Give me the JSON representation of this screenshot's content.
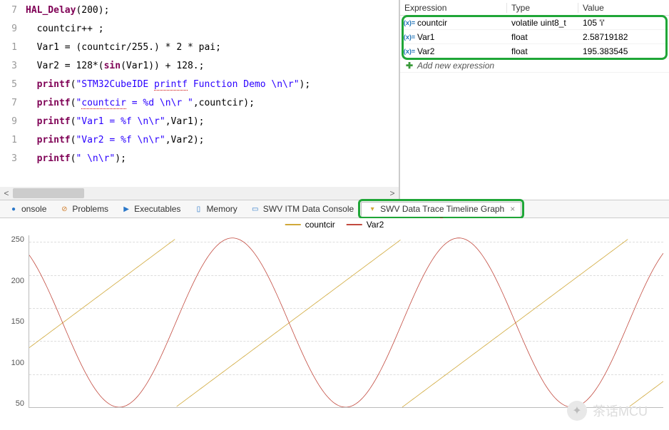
{
  "code": {
    "lines": [
      {
        "n": 7,
        "html": "<span class='kw'>HAL_Delay</span>(200);"
      },
      {
        "n": 9,
        "html": "  countcir++ ;"
      },
      {
        "n": 1,
        "html": "  Var1 = (countcir/255.) * 2 * pai;"
      },
      {
        "n": 3,
        "html": "  Var2 = 128*(<span class='kw'>sin</span>(Var1)) + 128.;"
      },
      {
        "n": 5,
        "html": "  <span class='kw'>printf</span>(<span class='str'>&quot;STM32CubeIDE <span class='squig'>printf</span> Function Demo \\n\\r&quot;</span>);"
      },
      {
        "n": 7,
        "html": "  <span class='kw'>printf</span>(<span class='str'>&quot;<span class='squig'>countcir</span> = %d \\n\\r &quot;</span>,countcir);"
      },
      {
        "n": 9,
        "html": "  <span class='kw'>printf</span>(<span class='str'>&quot;Var1 = %f \\n\\r&quot;</span>,Var1);"
      },
      {
        "n": 1,
        "html": "  <span class='kw'>printf</span>(<span class='str'>&quot;Var2 = %f \\n\\r&quot;</span>,Var2);"
      },
      {
        "n": 3,
        "html": "  <span class='kw'>printf</span>(<span class='str'>&quot; \\n\\r&quot;</span>);"
      }
    ]
  },
  "expressions": {
    "header": {
      "expr": "Expression",
      "type": "Type",
      "value": "Value"
    },
    "rows": [
      {
        "name": "countcir",
        "type": "volatile uint8_t",
        "value": "105 'i'"
      },
      {
        "name": "Var1",
        "type": "float",
        "value": "2.58719182"
      },
      {
        "name": "Var2",
        "type": "float",
        "value": "195.383545"
      }
    ],
    "add_text": "Add new expression"
  },
  "tabs": {
    "items": [
      {
        "icon": "●",
        "icon_color": "#2a77c9",
        "label": "onsole"
      },
      {
        "icon": "⊘",
        "icon_color": "#d07d2a",
        "label": "Problems"
      },
      {
        "icon": "▶",
        "icon_color": "#2a77c9",
        "label": "Executables"
      },
      {
        "icon": "▯",
        "icon_color": "#2a77c9",
        "label": "Memory"
      },
      {
        "icon": "▭",
        "icon_color": "#2a77c9",
        "label": "SWV ITM Data Console"
      },
      {
        "icon": "▾",
        "icon_color": "#d0a839",
        "label": "SWV Data Trace Timeline Graph",
        "active": true,
        "closable": true
      }
    ]
  },
  "chart_data": {
    "type": "line",
    "title": "",
    "xlabel": "",
    "ylabel": "",
    "ylim": [
      0,
      260
    ],
    "x_range": [
      0,
      714
    ],
    "y_ticks": [
      50,
      100,
      150,
      200,
      250
    ],
    "legend_position": "top",
    "series": [
      {
        "name": "countcir",
        "color": "#d0a839",
        "type": "sawtooth",
        "period": 255,
        "amplitude": 255,
        "phase": 90,
        "description": "Linear ramp 0→255 repeating every 255 x-units"
      },
      {
        "name": "Var2",
        "color": "#c24a3f",
        "type": "sine",
        "offset": 128,
        "amplitude": 128,
        "period": 255,
        "phase": 90,
        "formula": "128*sin(2*pi*x/255) + 128",
        "description": "Sinusoid oscillating between ~0 and ~256"
      }
    ]
  },
  "watermark": "茶话MCU"
}
